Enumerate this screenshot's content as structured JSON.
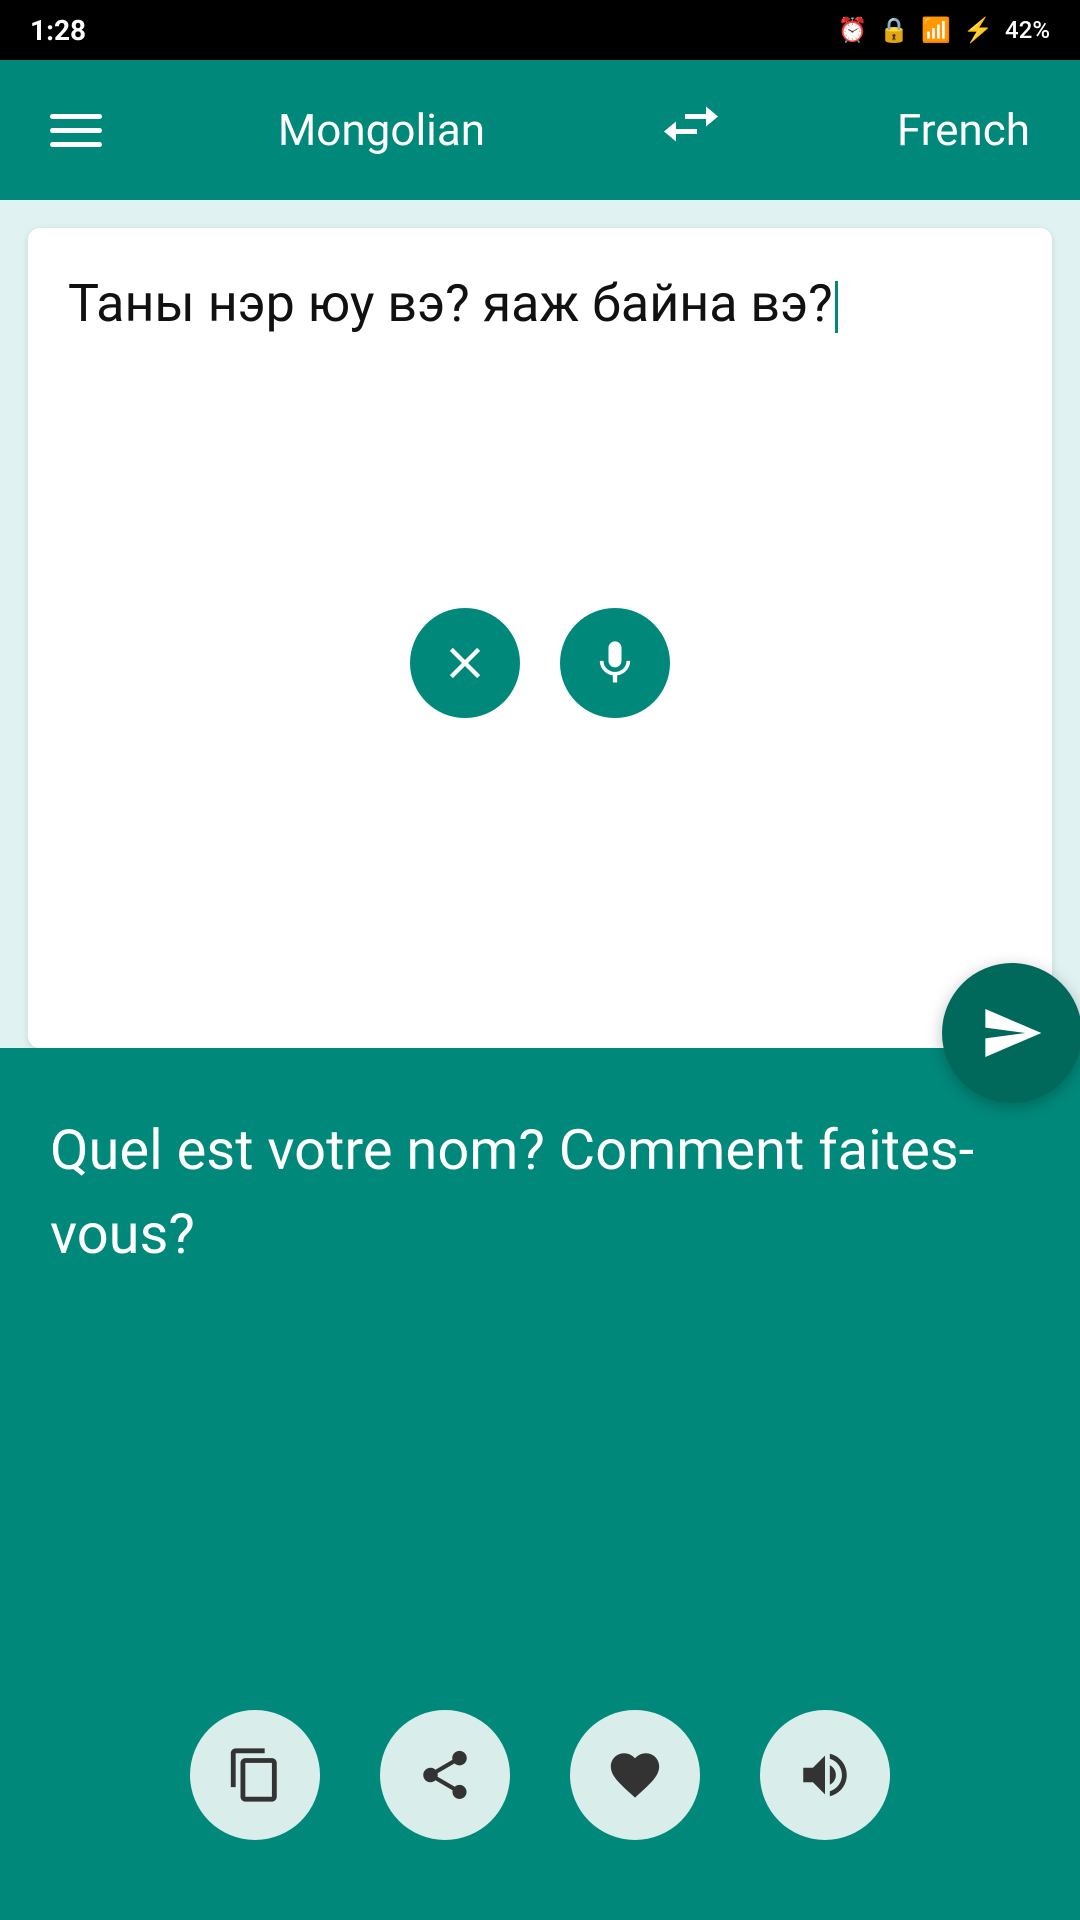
{
  "statusBar": {
    "time": "1:28",
    "battery": "42%"
  },
  "appBar": {
    "menuLabel": "Menu",
    "sourceLang": "Mongolian",
    "swapLabel": "Swap languages",
    "targetLang": "French"
  },
  "inputSection": {
    "text": "Таны нэр юу вэ? яаж байна вэ?",
    "clearLabel": "Clear",
    "micLabel": "Microphone",
    "sendLabel": "Send / Translate"
  },
  "outputSection": {
    "text": "Quel est votre nom? Comment faites-vous?",
    "copyLabel": "Copy",
    "shareLabel": "Share",
    "favoriteLabel": "Favorite",
    "speakLabel": "Speak"
  }
}
